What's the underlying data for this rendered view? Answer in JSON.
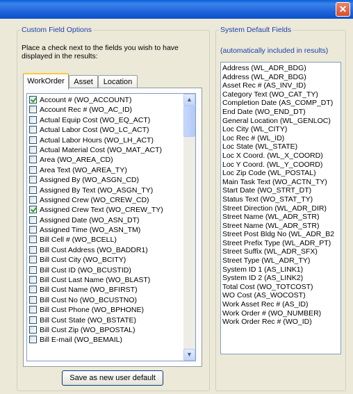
{
  "window": {
    "close_glyph": "✕"
  },
  "custom_fields": {
    "legend": "Custom Field Options",
    "instructions": "Place a check next to the fields you wish to have displayed in the results:",
    "tabs": [
      {
        "label": "WorkOrder",
        "active": true
      },
      {
        "label": "Asset",
        "active": false
      },
      {
        "label": "Location",
        "active": false
      }
    ],
    "items": [
      {
        "label": "Account # (WO_ACCOUNT)",
        "checked": true
      },
      {
        "label": "Account Rec # (WO_AC_ID)",
        "checked": false
      },
      {
        "label": "Actual Equip Cost (WO_EQ_ACT)",
        "checked": false
      },
      {
        "label": "Actual Labor Cost (WO_LC_ACT)",
        "checked": false
      },
      {
        "label": "Actual Labor Hours (WO_LH_ACT)",
        "checked": false
      },
      {
        "label": "Actual Material Cost (WO_MAT_ACT)",
        "checked": false
      },
      {
        "label": "Area (WO_AREA_CD)",
        "checked": false
      },
      {
        "label": "Area Text (WO_AREA_TY)",
        "checked": false
      },
      {
        "label": "Assigned By (WO_ASGN_CD)",
        "checked": false
      },
      {
        "label": "Assigned By Text (WO_ASGN_TY)",
        "checked": false
      },
      {
        "label": "Assigned Crew (WO_CREW_CD)",
        "checked": false
      },
      {
        "label": "Assigned Crew Text (WO_CREW_TY)",
        "checked": true
      },
      {
        "label": "Assigned Date (WO_ASN_DT)",
        "checked": false
      },
      {
        "label": "Assigned Time (WO_ASN_TM)",
        "checked": false
      },
      {
        "label": "Bill Cell # (WO_BCELL)",
        "checked": false
      },
      {
        "label": "Bill Cust Address (WO_BADDR1)",
        "checked": false
      },
      {
        "label": "Bill Cust City (WO_BCITY)",
        "checked": false
      },
      {
        "label": "Bill Cust ID (WO_BCUSTID)",
        "checked": false
      },
      {
        "label": "Bill Cust Last Name (WO_BLAST)",
        "checked": false
      },
      {
        "label": "Bill Cust Name (WO_BFIRST)",
        "checked": false
      },
      {
        "label": "Bill Cust No (WO_BCUSTNO)",
        "checked": false
      },
      {
        "label": "Bill Cust Phone (WO_BPHONE)",
        "checked": false
      },
      {
        "label": "Bill Cust State (WO_BSTATE)",
        "checked": false
      },
      {
        "label": "Bill Cust Zip (WO_BPOSTAL)",
        "checked": false
      },
      {
        "label": "Bill E-mail (WO_BEMAIL)",
        "checked": false
      }
    ],
    "scroll_up_glyph": "▲",
    "scroll_down_glyph": "▼",
    "save_button": "Save as new user default"
  },
  "system_defaults": {
    "legend": "System Default Fields",
    "caption": "(automatically included in results)",
    "items": [
      "Address (WL_ADR_BDG)",
      "Address (WL_ADR_BDG)",
      "Asset Rec # (AS_INV_ID)",
      "Category Text (WO_CAT_TY)",
      "Completion Date (AS_COMP_DT)",
      "End Date (WO_END_DT)",
      "General Location (WL_GENLOC)",
      "Loc City (WL_CITY)",
      "Loc Rec # (WL_ID)",
      "Loc State (WL_STATE)",
      "Loc X Coord. (WL_X_COORD)",
      "Loc Y Coord. (WL_Y_COORD)",
      "Loc Zip Code (WL_POSTAL)",
      "Main Task Text (WO_ACTN_TY)",
      "Start Date (WO_STRT_DT)",
      "Status Text (WO_STAT_TY)",
      "Street Direction (WL_ADR_DIR)",
      "Street Name (WL_ADR_STR)",
      "Street Name (WL_ADR_STR)",
      "Street Post Bldg No (WL_ADR_B2",
      "Street Prefix Type (WL_ADR_PT)",
      "Street Suffix (WL_ADR_SFX)",
      "Street Type (WL_ADR_TY)",
      "System ID 1 (AS_LINK1)",
      "System ID 2 (AS_LINK2)",
      "Total Cost (WO_TOTCOST)",
      "WO Cost (AS_WOCOST)",
      "Work Asset Rec # (AS_ID)",
      "Work Order # (WO_NUMBER)",
      "Work Order Rec # (WO_ID)"
    ]
  }
}
